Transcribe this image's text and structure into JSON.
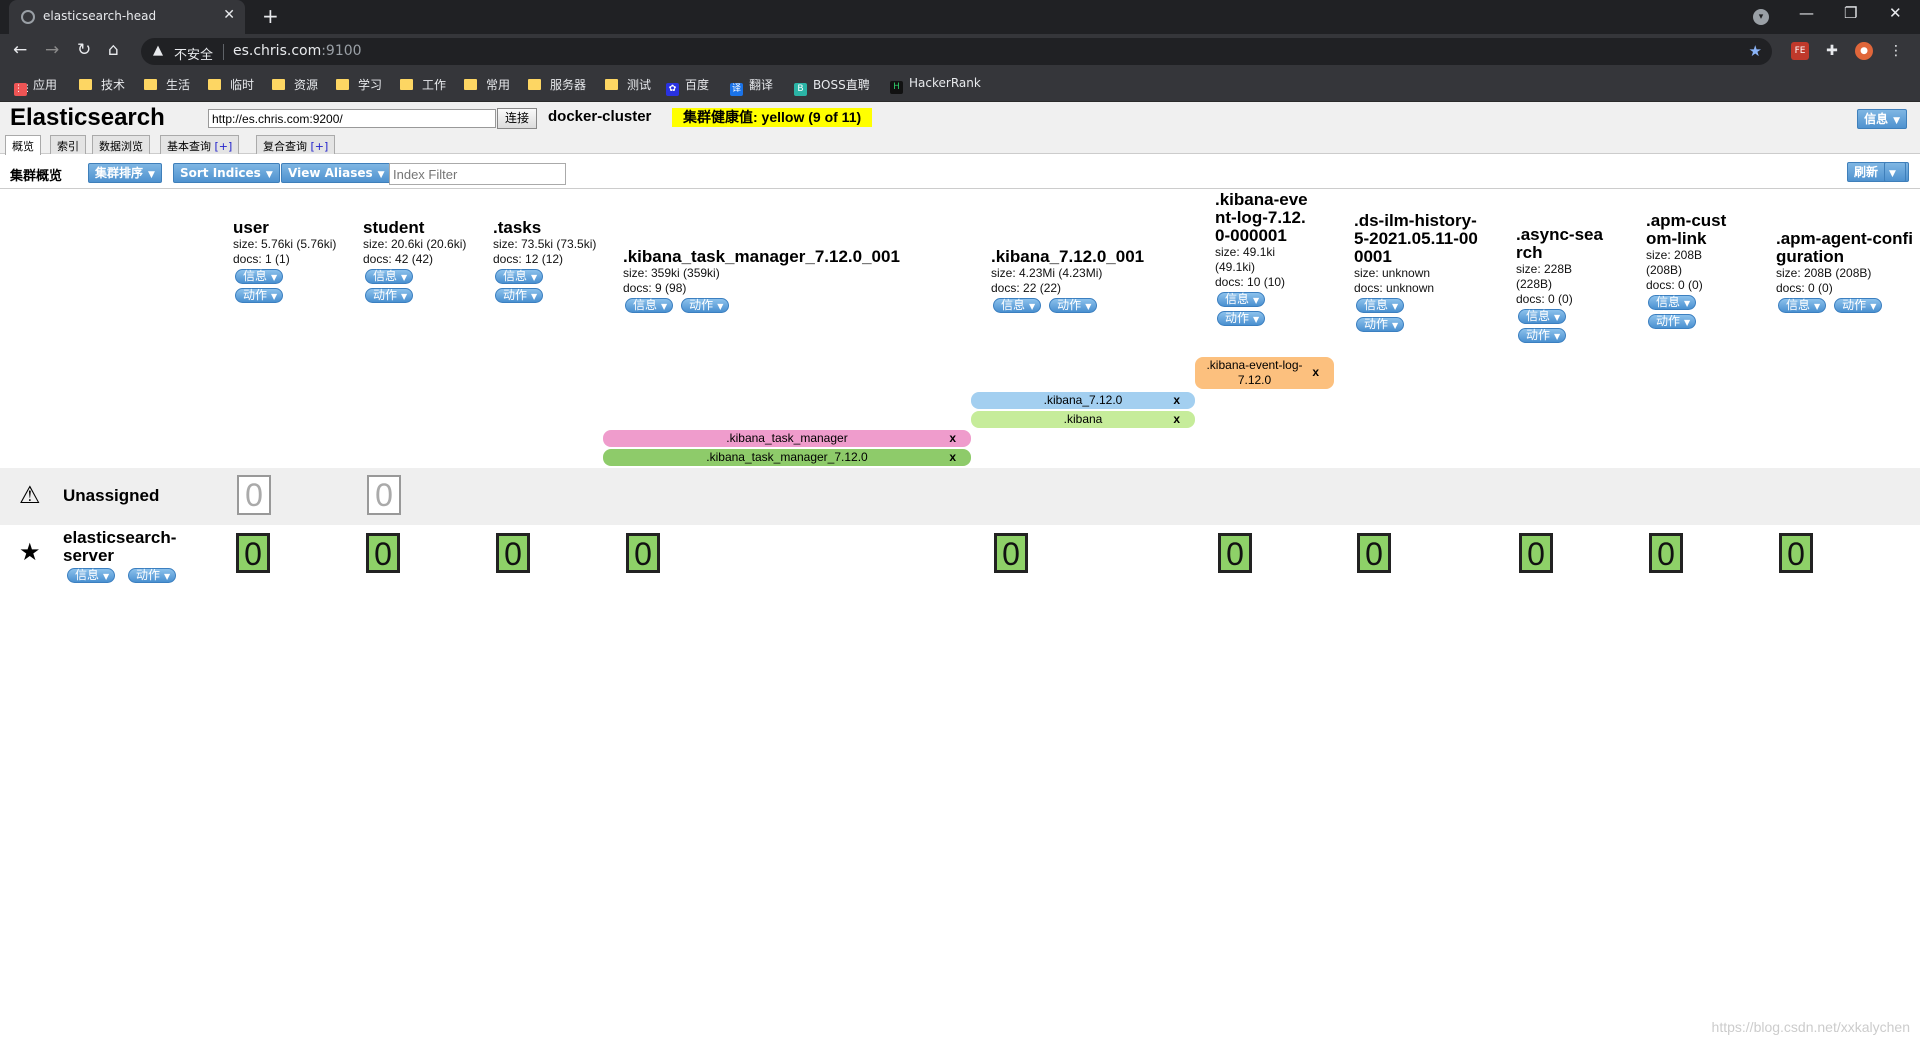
{
  "browser": {
    "tab_title": "elasticsearch-head",
    "new_tab": "+",
    "url_insecure": "不安全",
    "url_host": "es.chris.com",
    "url_port": ":9100",
    "bookmarks": [
      "应用",
      "技术",
      "生活",
      "临时",
      "资源",
      "学习",
      "工作",
      "常用",
      "服务器",
      "测试",
      "百度",
      "翻译",
      "BOSS直聘",
      "HackerRank"
    ]
  },
  "header": {
    "logo": "Elasticsearch",
    "connect_url": "http://es.chris.com:9200/",
    "connect_label": "连接",
    "cluster_name": "docker-cluster",
    "health": "集群健康值: yellow (9 of 11)",
    "info_label": "信息"
  },
  "tabs": [
    {
      "label": "概览"
    },
    {
      "label": "索引"
    },
    {
      "label": "数据浏览"
    },
    {
      "label": "基本查询",
      "plus": "[+]"
    },
    {
      "label": "复合查询",
      "plus": "[+]"
    }
  ],
  "subbar": {
    "title": "集群概览",
    "sort_cluster": "集群排序",
    "sort_indices": "Sort Indices",
    "view_aliases": "View Aliases",
    "filter_placeholder": "Index Filter",
    "refresh": "刷新"
  },
  "buttons": {
    "info": "信息",
    "action": "动作"
  },
  "indices": [
    {
      "name": "user",
      "size": "size: 5.76ki (5.76ki)",
      "docs": "docs: 1 (1)"
    },
    {
      "name": "student",
      "size": "size: 20.6ki (20.6ki)",
      "docs": "docs: 42 (42)"
    },
    {
      "name": ".tasks",
      "size": "size: 73.5ki (73.5ki)",
      "docs": "docs: 12 (12)"
    },
    {
      "name": ".kibana_task_manager_7.12.0_001",
      "size": "size: 359ki (359ki)",
      "docs": "docs: 9 (98)"
    },
    {
      "name": ".kibana_7.12.0_001",
      "size": "size: 4.23Mi (4.23Mi)",
      "docs": "docs: 22 (22)"
    },
    {
      "name": ".kibana-event-log-7.12.0-000001",
      "size": "size: 49.1ki (49.1ki)",
      "docs": "docs: 10 (10)"
    },
    {
      "name": ".ds-ilm-history-5-2021.05.11-000001",
      "size": "size: unknown",
      "docs": "docs: unknown"
    },
    {
      "name": ".async-search",
      "size": "size: 228B (228B)",
      "docs": "docs: 0 (0)"
    },
    {
      "name": ".apm-custom-link",
      "size": "size: 208B (208B)",
      "docs": "docs: 0 (0)"
    },
    {
      "name": ".apm-agent-configuration",
      "size": "size: 208B (208B)",
      "docs": "docs: 0 (0)"
    }
  ],
  "aliases": [
    {
      "label": ".kibana-event-log-7.12.0",
      "x": "x",
      "color": "#fcc07e"
    },
    {
      "label": ".kibana_7.12.0",
      "x": "x",
      "color": "#a3cff0"
    },
    {
      "label": ".kibana",
      "x": "x",
      "color": "#c6ec9a"
    },
    {
      "label": ".kibana_task_manager",
      "x": "x",
      "color": "#ef9ccc"
    },
    {
      "label": ".kibana_task_manager_7.12.0",
      "x": "x",
      "color": "#8ecb6a"
    }
  ],
  "unassigned": {
    "label": "Unassigned",
    "shards": [
      "0",
      "0"
    ]
  },
  "node": {
    "name": "elasticsearch-server",
    "shards": [
      "0",
      "0",
      "0",
      "0",
      "0",
      "0",
      "0",
      "0",
      "0",
      "0"
    ]
  },
  "watermark": "https://blog.csdn.net/xxkalychen"
}
